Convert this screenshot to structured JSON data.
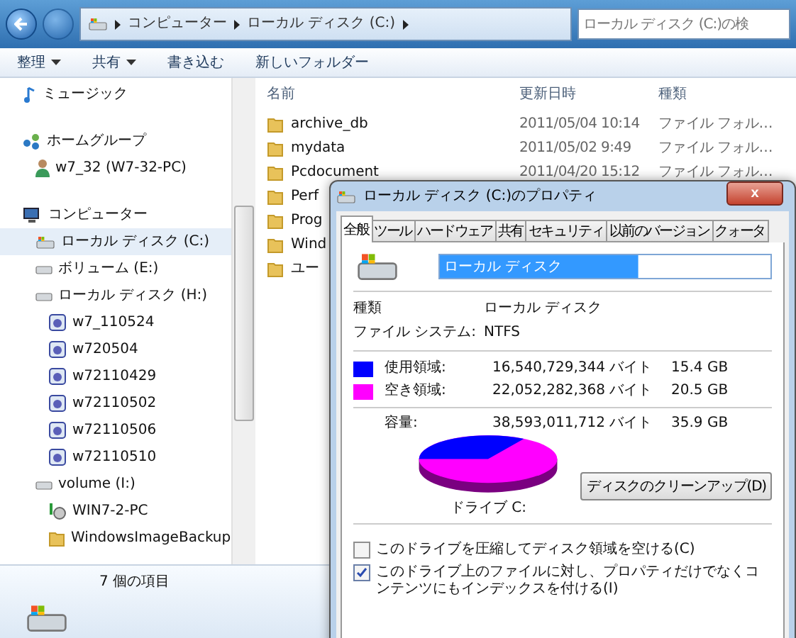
{
  "address_bar": {
    "path": [
      "コンピューター",
      "ローカル ディスク (C:)"
    ]
  },
  "search": {
    "placeholder": "ローカル ディスク (C:)の検"
  },
  "toolbar": [
    {
      "label": "整理",
      "dropdown": true
    },
    {
      "label": "共有",
      "dropdown": true
    },
    {
      "label": "書き込む",
      "dropdown": false
    },
    {
      "label": "新しいフォルダー",
      "dropdown": false
    }
  ],
  "nav": [
    {
      "label": "ミュージック",
      "kind": "music",
      "selected": false
    },
    {
      "label": "ホームグループ",
      "kind": "homegroup",
      "selected": false,
      "children": [
        {
          "label": "w7_32 (W7-32-PC)",
          "kind": "user",
          "selected": false
        }
      ]
    },
    {
      "label": "コンピューター",
      "kind": "computer",
      "selected": false,
      "children": [
        {
          "label": "ローカル ディスク (C:)",
          "kind": "sysdrive",
          "selected": true
        },
        {
          "label": "ボリューム (E:)",
          "kind": "drive",
          "selected": false
        },
        {
          "label": "ローカル ディスク (H:)",
          "kind": "drive",
          "selected": false,
          "children": [
            {
              "label": "w7_110524",
              "kind": "image",
              "selected": false
            },
            {
              "label": "w720504",
              "kind": "image",
              "selected": false
            },
            {
              "label": "w72110429",
              "kind": "image",
              "selected": false
            },
            {
              "label": "w72110502",
              "kind": "image",
              "selected": false
            },
            {
              "label": "w72110506",
              "kind": "image",
              "selected": false
            },
            {
              "label": "w72110510",
              "kind": "image",
              "selected": false
            }
          ]
        },
        {
          "label": "volume (I:)",
          "kind": "drive",
          "selected": false,
          "children": [
            {
              "label": "WIN7-2-PC",
              "kind": "network",
              "selected": false
            },
            {
              "label": "WindowsImageBackup",
              "kind": "folder",
              "selected": false
            }
          ]
        }
      ]
    }
  ],
  "file_list": {
    "columns": [
      "名前",
      "更新日時",
      "種類"
    ],
    "rows": [
      {
        "name": "archive_db",
        "date": "2011/05/04 10:14",
        "type": "ファイル フォル…"
      },
      {
        "name": "mydata",
        "date": "2011/05/02 9:49",
        "type": "ファイル フォル…"
      },
      {
        "name": "Pcdocument",
        "date": "2011/04/20 15:12",
        "type": "ファイル フォル…"
      },
      {
        "name": "Perf"
      },
      {
        "name": "Prog"
      },
      {
        "name": "Wind"
      },
      {
        "name": "ユー"
      }
    ]
  },
  "status_bar": {
    "count": "7 個の項目"
  },
  "dialog": {
    "title": "ローカル ディスク (C:)のプロパティ",
    "close": "x",
    "tabs": [
      {
        "label": "全般",
        "selected": true
      },
      {
        "label": "ツール",
        "selected": false
      },
      {
        "label": "ハードウェア",
        "selected": false
      },
      {
        "label": "共有",
        "selected": false
      },
      {
        "label": "セキュリティ",
        "selected": false
      },
      {
        "label": "以前のバージョン",
        "selected": false
      },
      {
        "label": "クォータ",
        "selected": false
      }
    ],
    "name_field": "ローカル ディスク",
    "type_label": "種類",
    "type_value": "ローカル ディスク",
    "fs_label": "ファイル システム:",
    "fs_value": "NTFS",
    "space": [
      {
        "label": "使用領域:",
        "bytes": "16,540,729,344 バイト",
        "size": "15.4 GB",
        "color": "#0000ff"
      },
      {
        "label": "空き領域:",
        "bytes": "22,052,282,368 バイト",
        "size": "20.5 GB",
        "color": "#ff00ff"
      }
    ],
    "capacity": {
      "label": "容量:",
      "bytes": "38,593,011,712 バイト",
      "size": "35.9 GB"
    },
    "drive_label": "ドライブ C:",
    "cleanup_button": "ディスクのクリーンアップ(D)",
    "options": [
      {
        "label": "このドライブを圧縮してディスク領域を空ける(C)",
        "checked": false
      },
      {
        "label": "このドライブ上のファイルに対し、プロパティだけでなくコンテンツにもインデックスを付ける(I)",
        "checked": true
      }
    ]
  }
}
